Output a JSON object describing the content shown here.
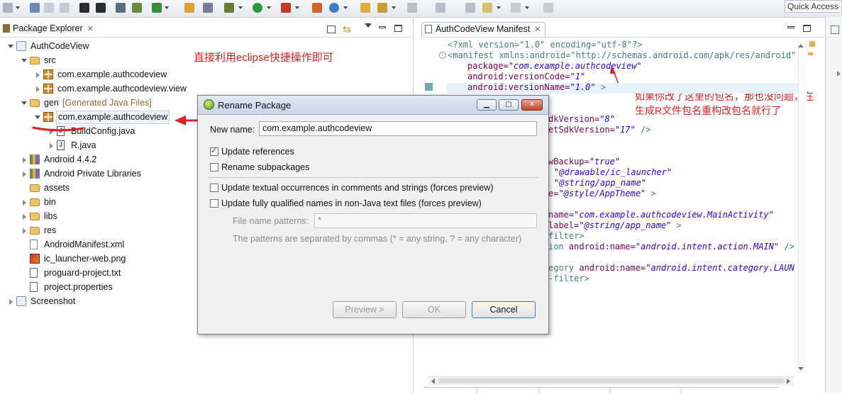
{
  "toolbar": {
    "quick_access": "Quick Access"
  },
  "package_explorer": {
    "tab_title": "Package Explorer",
    "tree": [
      {
        "label": "AuthCodeView",
        "depth": 0,
        "icon": "project-icon",
        "open": true
      },
      {
        "label": "src",
        "depth": 1,
        "icon": "source-folder-icon",
        "open": true
      },
      {
        "label": "com.example.authcodeview",
        "depth": 2,
        "icon": "package-icon",
        "open": false
      },
      {
        "label": "com.example.authcodeview.view",
        "depth": 2,
        "icon": "package-icon",
        "open": false
      },
      {
        "label": "gen",
        "depth": 1,
        "icon": "source-folder-icon",
        "open": true,
        "suffix": "[Generated Java Files]"
      },
      {
        "label": "com.example.authcodeview",
        "depth": 2,
        "icon": "package-icon",
        "open": true,
        "selected": true
      },
      {
        "label": "BuildConfig.java",
        "depth": 3,
        "icon": "java-file-icon",
        "open": false
      },
      {
        "label": "R.java",
        "depth": 3,
        "icon": "java-file-icon",
        "open": false
      },
      {
        "label": "Android 4.4.2",
        "depth": 1,
        "icon": "library-icon",
        "open": false
      },
      {
        "label": "Android Private Libraries",
        "depth": 1,
        "icon": "library-icon",
        "open": false
      },
      {
        "label": "assets",
        "depth": 1,
        "icon": "folder-icon",
        "leaf": true
      },
      {
        "label": "bin",
        "depth": 1,
        "icon": "folder-icon",
        "open": false
      },
      {
        "label": "libs",
        "depth": 1,
        "icon": "folder-icon",
        "open": false
      },
      {
        "label": "res",
        "depth": 1,
        "icon": "folder-icon",
        "open": false
      },
      {
        "label": "AndroidManifest.xml",
        "depth": 1,
        "icon": "xml-file-icon",
        "leaf": true
      },
      {
        "label": "ic_launcher-web.png",
        "depth": 1,
        "icon": "image-file-icon",
        "leaf": true
      },
      {
        "label": "proguard-project.txt",
        "depth": 1,
        "icon": "text-file-icon",
        "leaf": true
      },
      {
        "label": "project.properties",
        "depth": 1,
        "icon": "text-file-icon",
        "leaf": true
      },
      {
        "label": "Screenshot",
        "depth": 0,
        "icon": "project-icon",
        "open": false
      }
    ]
  },
  "annotations": {
    "left_note": "直接利用eclipse快捷操作即可",
    "right_note_line1": "如果你改了这里的包名，那也没问题，在",
    "right_note_line2": "生成R文件包名重构改包名就行了"
  },
  "editor": {
    "tab_title": "AuthCodeView Manifest",
    "line1": "<?xml version=\"1.0\" encoding=\"utf-8\"?>",
    "line2": "<manifest xmlns:android=\"http://schemas.android.com/apk/res/android\"",
    "line3_attr": "package=",
    "line3_val": "\"com.example.authcodeview\"",
    "line4_attr": "android:versionCode=",
    "line4_val": "\"1\"",
    "line5_attr": "android:versionName=",
    "line5_val": "\"1.0\"",
    "line5_end": " >",
    "frag1_a": "dkVersion=",
    "frag1_v": "\"8\"",
    "frag2_a": "etSdkVersion=",
    "frag2_v": "\"17\"",
    "frag2_e": " />",
    "frag3_a": "wBackup=",
    "frag3_v": "\"true\"",
    "frag4_v": "\"@drawable/ic_launcher\"",
    "frag5_v": "\"@string/app_name\"",
    "frag6_a": "e=",
    "frag6_v": "\"@style/AppTheme\"",
    "frag6_e": " >",
    "frag7_a": "name=",
    "frag7_v": "\"com.example.authcodeview.MainActivity\"",
    "frag8_a": "label=",
    "frag8_v": "\"@string/app_name\"",
    "frag8_e": " >",
    "frag9": "filter>",
    "frag10_t": "ion ",
    "frag10_a": "android:name=",
    "frag10_v": "\"android.intent.action.MAIN\"",
    "frag10_e": " />",
    "frag11_t": "egory ",
    "frag11_a": "android:name=",
    "frag11_v": "\"android.intent.category.LAUNCH",
    "frag12": "-filter>"
  },
  "dialog": {
    "title": "Rename Package",
    "new_name_label": "New name:",
    "new_name_value": "com.example.authcodeview",
    "update_references": "Update references",
    "rename_subpackages": "Rename subpackages",
    "update_textual": "Update textual occurrences in comments and strings (forces preview)",
    "update_fqn": "Update fully qualified names in non-Java text files (forces preview)",
    "file_name_patterns_label": "File name patterns:",
    "file_name_patterns_value": "*",
    "patterns_hint": "The patterns are separated by commas (* = any string, ? = any character)",
    "preview_button": "Preview >",
    "ok_button": "OK",
    "cancel_button": "Cancel"
  }
}
